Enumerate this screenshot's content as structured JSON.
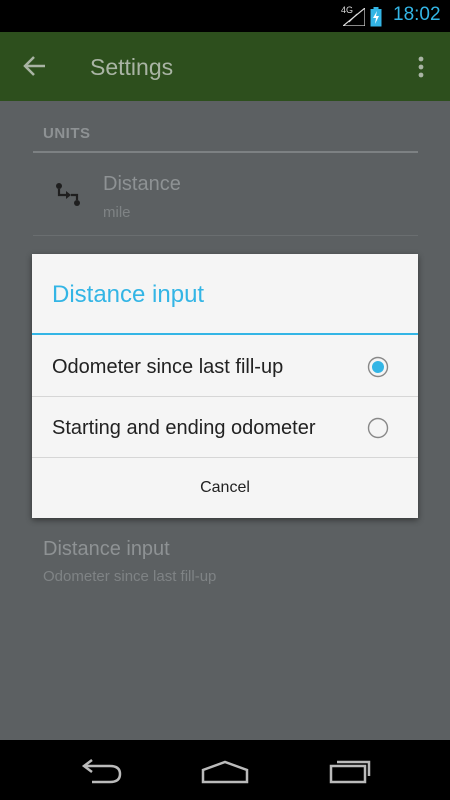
{
  "status_bar": {
    "network": "4G",
    "time": "18:02"
  },
  "app_bar": {
    "title": "Settings",
    "back_icon": "arrow-back-icon",
    "overflow_icon": "overflow-menu-icon"
  },
  "settings": {
    "section_header": "UNITS",
    "distance": {
      "label": "Distance",
      "summary": "mile",
      "icon": "distance-icon"
    },
    "distance_input": {
      "label": "Distance input",
      "summary": "Odometer since last fill-up"
    }
  },
  "dialog": {
    "title": "Distance input",
    "options": [
      {
        "label": "Odometer since last fill-up",
        "selected": true
      },
      {
        "label": "Starting and ending odometer",
        "selected": false
      }
    ],
    "cancel_label": "Cancel"
  },
  "colors": {
    "accent": "#33b5e5",
    "app_bar": "#2d4f1d",
    "dim_background": "#5c6062"
  }
}
